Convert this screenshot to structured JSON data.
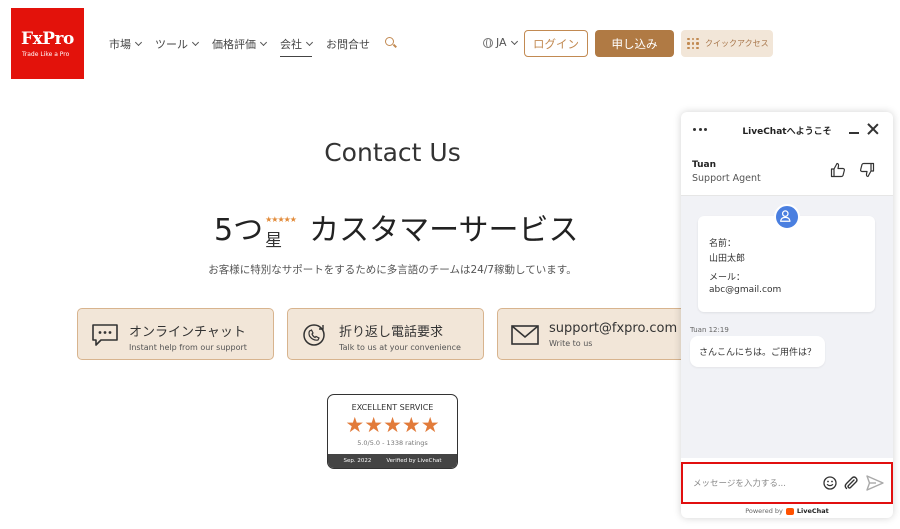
{
  "logo": {
    "brand": "FxPro",
    "tagline": "Trade Like a Pro"
  },
  "nav": {
    "items": [
      {
        "label": "市場",
        "has_dropdown": true
      },
      {
        "label": "ツール",
        "has_dropdown": true
      },
      {
        "label": "価格評価",
        "has_dropdown": true
      },
      {
        "label": "会社",
        "has_dropdown": true,
        "active": true
      },
      {
        "label": "お問合せ",
        "has_dropdown": false
      }
    ]
  },
  "header": {
    "language": "JA",
    "login_label": "ログイン",
    "apply_label": "申し込み",
    "quick_access_label": "クイックアクセス"
  },
  "main": {
    "title": "Contact Us",
    "heading_prefix": "5つ",
    "heading_star_mini": "★★★★★",
    "heading_star_kanji": "星",
    "heading_suffix": "カスタマーサービス",
    "subtitle": "お客様に特別なサポートをするために多言語のチームは24/7稼動しています。",
    "cards": [
      {
        "title": "オンラインチャット",
        "subtitle": "Instant help from our support",
        "icon": "chat-bubble-icon"
      },
      {
        "title": "折り返し電話要求",
        "subtitle": "Talk to us at your convenience",
        "icon": "phone-callback-icon"
      },
      {
        "title": "support@fxpro.com",
        "subtitle": "Write to us",
        "icon": "envelope-icon"
      }
    ],
    "badge": {
      "heading": "EXCELLENT SERVICE",
      "stars": "★★★★★",
      "rating": "5.0/5.0 - 1338 ratings",
      "date": "Sep. 2022",
      "verified": "Verified by LiveChat"
    }
  },
  "chat": {
    "title": "LiveChatへようこそ",
    "agent_name": "Tuan",
    "agent_role": "Support Agent",
    "form": {
      "name_label": "名前：",
      "name_value": "山田太郎",
      "email_label": "メール：",
      "email_value": "abc@gmail.com"
    },
    "message_time": "Tuan 12:19",
    "message_text": "さんこんにちは。ご用件は？",
    "input_placeholder": "メッセージを入力する...",
    "powered_prefix": "Powered by",
    "powered_brand": "LiveChat"
  },
  "colors": {
    "brand_red": "#e3120b",
    "accent_gold": "#b07a44",
    "card_bg": "#f2e6d8",
    "avatar_blue": "#4a7fe0",
    "highlight_red": "#e10f0f"
  }
}
